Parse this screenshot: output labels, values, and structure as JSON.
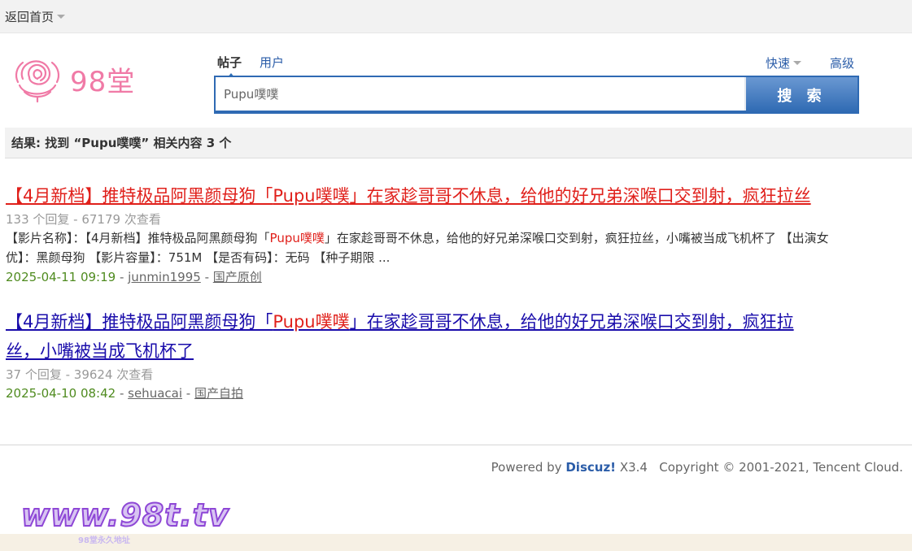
{
  "topbar": {
    "back_home": "返回首页"
  },
  "logo": {
    "text": "98堂",
    "icon": "rose-icon"
  },
  "search": {
    "tab_posts": "帖子",
    "tab_users": "用户",
    "quick": "快速",
    "advanced": "高级",
    "placeholder": "Pupu噗噗",
    "button": "搜 索"
  },
  "result_header": "结果: 找到 “Pupu噗噗” 相关内容 3 个",
  "results": [
    {
      "title_pre": "【4月新档】推特极品阿黑颜母狗「",
      "title_hl": "Pupu噗噗",
      "title_post": "」在家趁哥哥不休息，给他的好兄弟深喉口交到射，疯狂拉丝",
      "meta": "133 个回复 - 67179 次查看",
      "summary_pre": "【影片名称】：【4月新档】推特极品阿黑颜母狗「",
      "summary_hl": "Pupu噗噗",
      "summary_post": "」在家趁哥哥不休息，给他的好兄弟深喉口交到射，疯狂拉丝，小嘴被当成飞机杯了 【出演女优】：黑颜母狗 【影片容量】：751M 【是否有码】：无码 【种子期限 ...",
      "date": "2025-04-11 09:19",
      "author": "junmin1995",
      "forum": "国产原创"
    },
    {
      "title_pre": "【4月新档】推特极品阿黑颜母狗「",
      "title_hl": "Pupu噗噗",
      "title_post": "」在家趁哥哥不休息，给他的好兄弟深喉口交到射，疯狂拉丝，小嘴被当成飞机杯了",
      "meta": "37 个回复 - 39624 次查看",
      "date": "2025-04-10 08:42",
      "author": "sehuacai",
      "forum": "国产自拍"
    }
  ],
  "footer": {
    "powered": "Powered by",
    "brand": "Discuz!",
    "version": "X3.4",
    "copyright": "Copyright © 2001-2021, Tencent Cloud."
  },
  "watermark": {
    "text": "www.98t.tv",
    "sub": "98堂永久地址"
  },
  "colors": {
    "accent": "#2f6ab3",
    "highlight": "#e0201b",
    "link_visited": "#1a0dab",
    "date": "#4f8b1f"
  }
}
